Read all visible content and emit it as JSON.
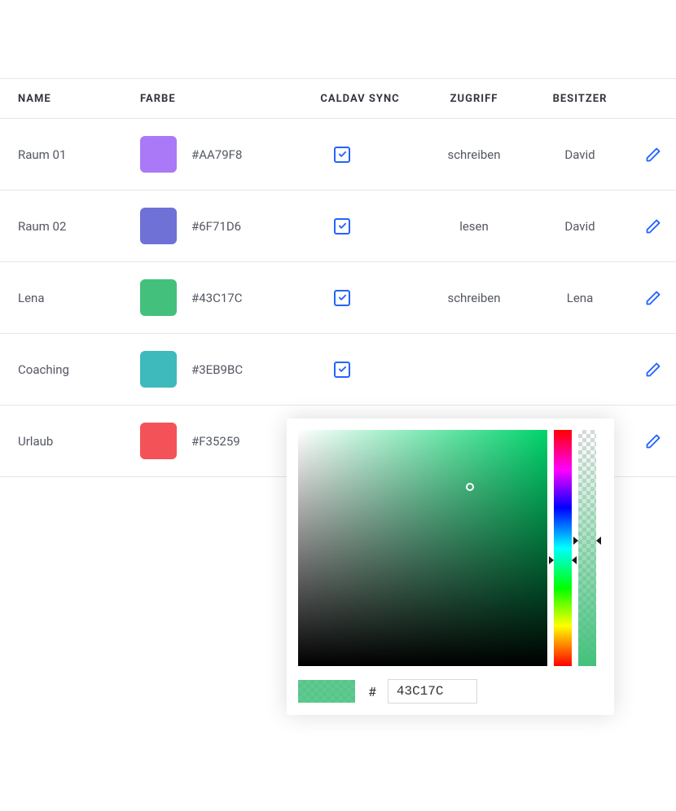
{
  "table": {
    "headers": {
      "name": "NAME",
      "color": "FARBE",
      "caldav": "CALDAV SYNC",
      "access": "ZUGRIFF",
      "owner": "BESITZER"
    },
    "rows": [
      {
        "name": "Raum 01",
        "hex": "#AA79F8",
        "swatch": "#AA79F8",
        "caldav": true,
        "access": "schreiben",
        "owner": "David"
      },
      {
        "name": "Raum 02",
        "hex": "#6F71D6",
        "swatch": "#6F71D6",
        "caldav": true,
        "access": "lesen",
        "owner": "David"
      },
      {
        "name": "Lena",
        "hex": "#43C17C",
        "swatch": "#43C17C",
        "caldav": true,
        "access": "schreiben",
        "owner": "Lena"
      },
      {
        "name": "Coaching",
        "hex": "#3EB9BC",
        "swatch": "#3EB9BC",
        "caldav": true,
        "access": "",
        "owner": ""
      },
      {
        "name": "Urlaub",
        "hex": "#F35259",
        "swatch": "#F35259",
        "caldav": true,
        "access": "",
        "owner": ""
      }
    ]
  },
  "picker": {
    "hash": "#",
    "hex_value": "43C17C",
    "selected_color": "#43C17C"
  },
  "icons": {
    "edit": "edit",
    "check": "check"
  }
}
